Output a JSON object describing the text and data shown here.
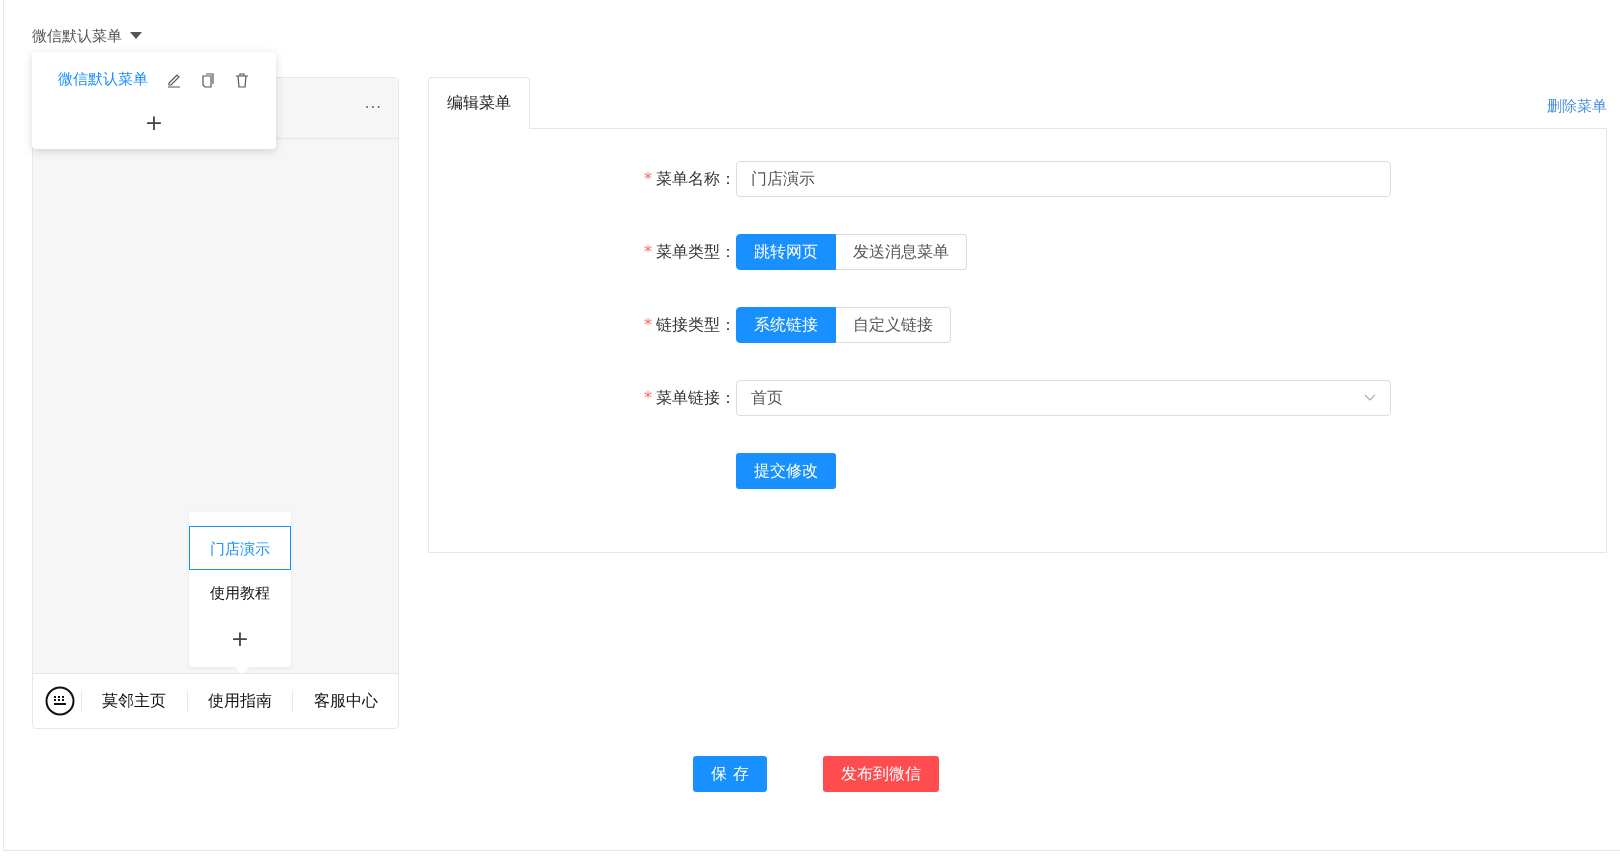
{
  "menu_selector": {
    "label": "微信默认菜单"
  },
  "menu_popover": {
    "items": [
      {
        "label": "微信默认菜单",
        "selected": true
      }
    ],
    "add": "+"
  },
  "phone": {
    "more": "···",
    "bottom_menu": [
      {
        "label": "莫邻主页",
        "expanded": false
      },
      {
        "label": "使用指南",
        "expanded": true,
        "submenu": [
          {
            "label": "门店演示",
            "selected": true
          },
          {
            "label": "使用教程",
            "selected": false
          }
        ],
        "add": "+"
      },
      {
        "label": "客服中心",
        "expanded": false
      }
    ]
  },
  "editor": {
    "tabs": [
      {
        "label": "编辑菜单",
        "selected": true
      }
    ],
    "delete_link": "删除菜单",
    "fields": [
      {
        "kind": "text",
        "required_mark": "*",
        "label": "菜单名称：",
        "value": "门店演示"
      },
      {
        "kind": "segmented",
        "required_mark": "*",
        "label": "菜单类型：",
        "options": [
          {
            "label": "跳转网页",
            "selected": true
          },
          {
            "label": "发送消息菜单",
            "selected": false
          }
        ]
      },
      {
        "kind": "segmented",
        "required_mark": "*",
        "label": "链接类型：",
        "options": [
          {
            "label": "系统链接",
            "selected": true
          },
          {
            "label": "自定义链接",
            "selected": false
          }
        ]
      },
      {
        "kind": "select",
        "required_mark": "*",
        "label": "菜单链接：",
        "value": "首页"
      }
    ],
    "submit": "提交修改"
  },
  "actions": [
    {
      "kind": "primary",
      "label": "保 存"
    },
    {
      "kind": "danger",
      "label": "发布到微信"
    }
  ]
}
